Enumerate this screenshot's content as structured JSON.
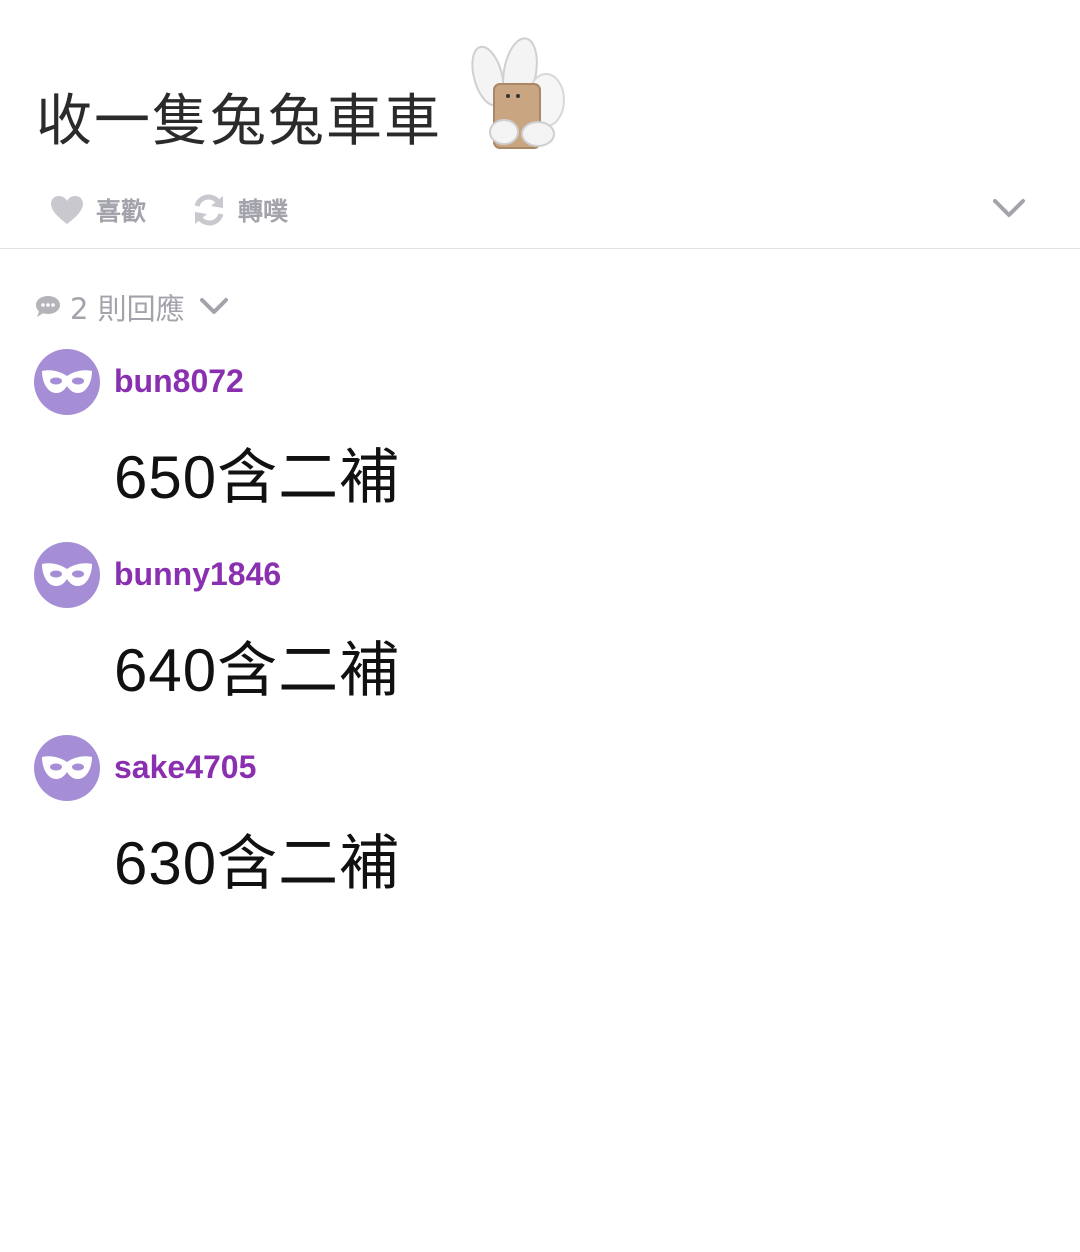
{
  "post": {
    "title": "收一隻兔兔車車",
    "sticker": "bunny-sticker"
  },
  "actions": {
    "like_label": "喜歡",
    "replurk_label": "轉噗",
    "like_icon": "heart-icon",
    "replurk_icon": "refresh-icon",
    "more_icon": "chevron-down-icon"
  },
  "responses_header": {
    "icon": "speech-bubble-icon",
    "text": "2 則回應"
  },
  "accent_color": "#8a2fb0",
  "avatar_color": "#a68ed6",
  "responses": [
    {
      "username": "bun8072",
      "content": "650含二補",
      "avatar_icon": "mask-icon"
    },
    {
      "username": "bunny1846",
      "content": "640含二補",
      "avatar_icon": "mask-icon"
    },
    {
      "username": "sake4705",
      "content": "630含二補",
      "avatar_icon": "mask-icon"
    }
  ]
}
